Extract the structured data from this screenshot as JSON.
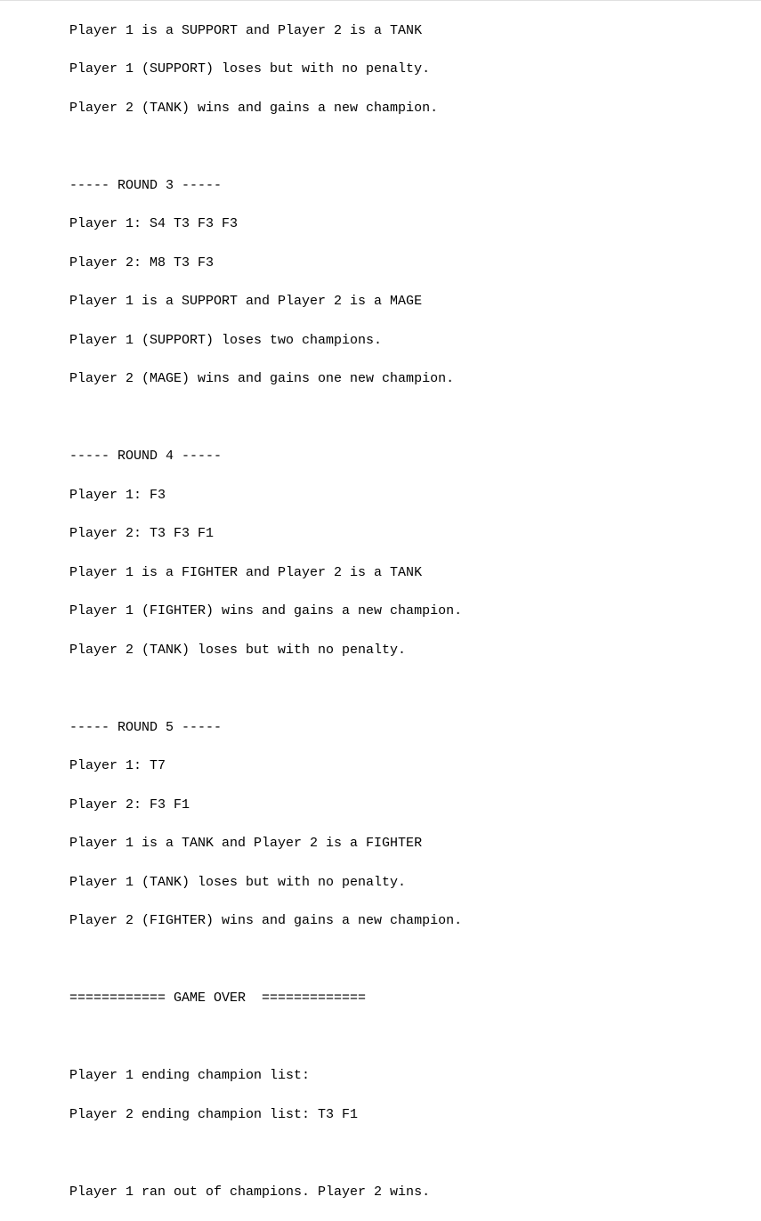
{
  "lines": [
    "Player 1 is a SUPPORT and Player 2 is a TANK",
    "Player 1 (SUPPORT) loses but with no penalty.",
    "Player 2 (TANK) wins and gains a new champion.",
    "",
    "----- ROUND 3 -----",
    "Player 1: S4 T3 F3 F3",
    "Player 2: M8 T3 F3",
    "Player 1 is a SUPPORT and Player 2 is a MAGE",
    "Player 1 (SUPPORT) loses two champions.",
    "Player 2 (MAGE) wins and gains one new champion.",
    "",
    "----- ROUND 4 -----",
    "Player 1: F3",
    "Player 2: T3 F3 F1",
    "Player 1 is a FIGHTER and Player 2 is a TANK",
    "Player 1 (FIGHTER) wins and gains a new champion.",
    "Player 2 (TANK) loses but with no penalty.",
    "",
    "----- ROUND 5 -----",
    "Player 1: T7",
    "Player 2: F3 F1",
    "Player 1 is a TANK and Player 2 is a FIGHTER",
    "Player 1 (TANK) loses but with no penalty.",
    "Player 2 (FIGHTER) wins and gains a new champion.",
    "",
    "============ GAME OVER  =============",
    "",
    "Player 1 ending champion list:",
    "Player 2 ending champion list: T3 F1",
    "",
    "Player 1 ran out of champions. Player 2 wins."
  ]
}
